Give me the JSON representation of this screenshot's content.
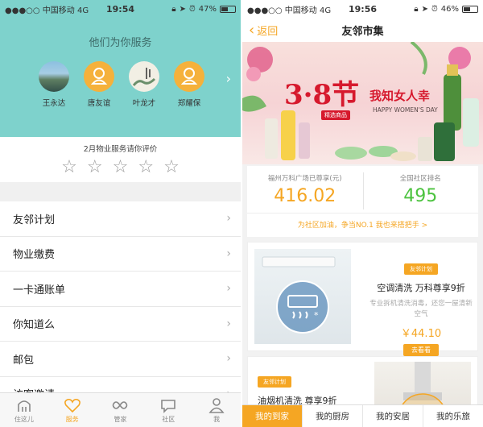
{
  "left": {
    "status": {
      "carrier": "●●●○○ 中国移动 4G",
      "time": "19:54",
      "battery": "47%",
      "battery_level": 0.47
    },
    "services_title": "他们为你服务",
    "providers": [
      {
        "name": "王永达",
        "avatar": "photo-landscape"
      },
      {
        "name": "唐友谊",
        "avatar": "default-user-icon"
      },
      {
        "name": "叶龙才",
        "avatar": "photo-calligraphy"
      },
      {
        "name": "郑耀保",
        "avatar": "default-user-icon"
      }
    ],
    "rating_prompt": "2月物业服务请你评价",
    "rating_stars": 5,
    "menu": [
      "友邻计划",
      "物业缴费",
      "一卡通账单",
      "你知道么",
      "邮包",
      "访客邀请"
    ],
    "tabs": [
      {
        "label": "住这儿",
        "icon": "house-icon",
        "active": false
      },
      {
        "label": "服务",
        "icon": "heart-icon",
        "active": true
      },
      {
        "label": "管家",
        "icon": "infinity-icon",
        "active": false
      },
      {
        "label": "社区",
        "icon": "chat-bubble-icon",
        "active": false
      },
      {
        "label": "我",
        "icon": "person-icon",
        "active": false
      }
    ]
  },
  "right": {
    "status": {
      "carrier": "●●●○○ 中国移动 4G",
      "time": "19:56",
      "battery": "46%",
      "battery_level": 0.46
    },
    "back_label": "返回",
    "title": "友邻市集",
    "banner": {
      "headline": "3·8节",
      "script": "我知女人幸",
      "english": "HAPPY WOMEN'S DAY",
      "badge": "精选商品"
    },
    "stats": {
      "saved_label": "福州万科广场已尊享(元)",
      "saved_value": "416.02",
      "rank_label": "全国社区排名",
      "rank_value": "495",
      "promo": "为社区加油，争当NO.1 我也来搭把手 >"
    },
    "cards": [
      {
        "tag": "友邻计划",
        "title": "空调清洗 万科尊享9折",
        "desc": "专业拆机清洗消毒，还您一屋清新空气",
        "price": "￥44.10",
        "button": "去看看"
      },
      {
        "tag": "友邻计划",
        "title": "油烟机清洗 尊享9折"
      }
    ],
    "bottom_tabs": [
      {
        "label": "我的到家",
        "active": true
      },
      {
        "label": "我的厨房",
        "active": false
      },
      {
        "label": "我的安居",
        "active": false
      },
      {
        "label": "我的乐旅",
        "active": false
      }
    ]
  },
  "colors": {
    "accent": "#f5a623",
    "teal": "#7ed2cc",
    "green": "#4cc33f"
  }
}
